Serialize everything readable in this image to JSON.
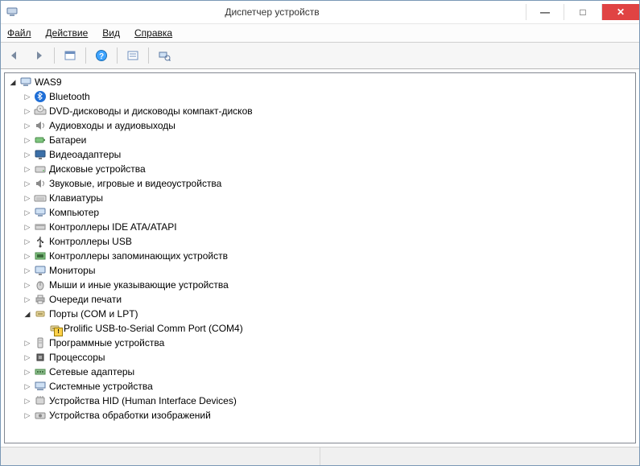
{
  "titlebar": {
    "title": "Диспетчер устройств",
    "minimize": "—",
    "maximize": "□",
    "close": "✕"
  },
  "menu": {
    "file": "Файл",
    "action": "Действие",
    "view": "Вид",
    "help": "Справка"
  },
  "toolbar": {
    "back_tip": "Back",
    "forward_tip": "Forward",
    "showhide_tip": "Show/Hide",
    "help_tip": "Help",
    "properties_tip": "Properties",
    "scan_tip": "Scan for hardware changes"
  },
  "tree": {
    "root": {
      "label": "WAS9",
      "icon": "computer-icon"
    },
    "categories": [
      {
        "label": "Bluetooth",
        "icon": "bluetooth-icon"
      },
      {
        "label": "DVD-дисководы и дисководы компакт-дисков",
        "icon": "disc-drive-icon"
      },
      {
        "label": "Аудиовходы и аудиовыходы",
        "icon": "speaker-icon"
      },
      {
        "label": "Батареи",
        "icon": "battery-icon"
      },
      {
        "label": "Видеоадаптеры",
        "icon": "display-adapter-icon"
      },
      {
        "label": "Дисковые устройства",
        "icon": "disk-icon"
      },
      {
        "label": "Звуковые, игровые и видеоустройства",
        "icon": "sound-icon"
      },
      {
        "label": "Клавиатуры",
        "icon": "keyboard-icon"
      },
      {
        "label": "Компьютер",
        "icon": "computer-icon"
      },
      {
        "label": "Контроллеры IDE ATA/ATAPI",
        "icon": "ide-icon"
      },
      {
        "label": "Контроллеры USB",
        "icon": "usb-icon"
      },
      {
        "label": "Контроллеры запоминающих устройств",
        "icon": "storage-controller-icon"
      },
      {
        "label": "Мониторы",
        "icon": "monitor-icon"
      },
      {
        "label": "Мыши и иные указывающие устройства",
        "icon": "mouse-icon"
      },
      {
        "label": "Очереди печати",
        "icon": "printer-icon"
      },
      {
        "label": "Порты (COM и LPT)",
        "icon": "port-icon",
        "expanded": true,
        "children": [
          {
            "label": "Prolific USB-to-Serial Comm Port (COM4)",
            "icon": "port-icon",
            "warning": true
          }
        ]
      },
      {
        "label": "Программные устройства",
        "icon": "software-device-icon"
      },
      {
        "label": "Процессоры",
        "icon": "cpu-icon"
      },
      {
        "label": "Сетевые адаптеры",
        "icon": "network-icon"
      },
      {
        "label": "Системные устройства",
        "icon": "system-device-icon"
      },
      {
        "label": "Устройства HID (Human Interface Devices)",
        "icon": "hid-icon"
      },
      {
        "label": "Устройства обработки изображений",
        "icon": "imaging-icon"
      }
    ]
  }
}
